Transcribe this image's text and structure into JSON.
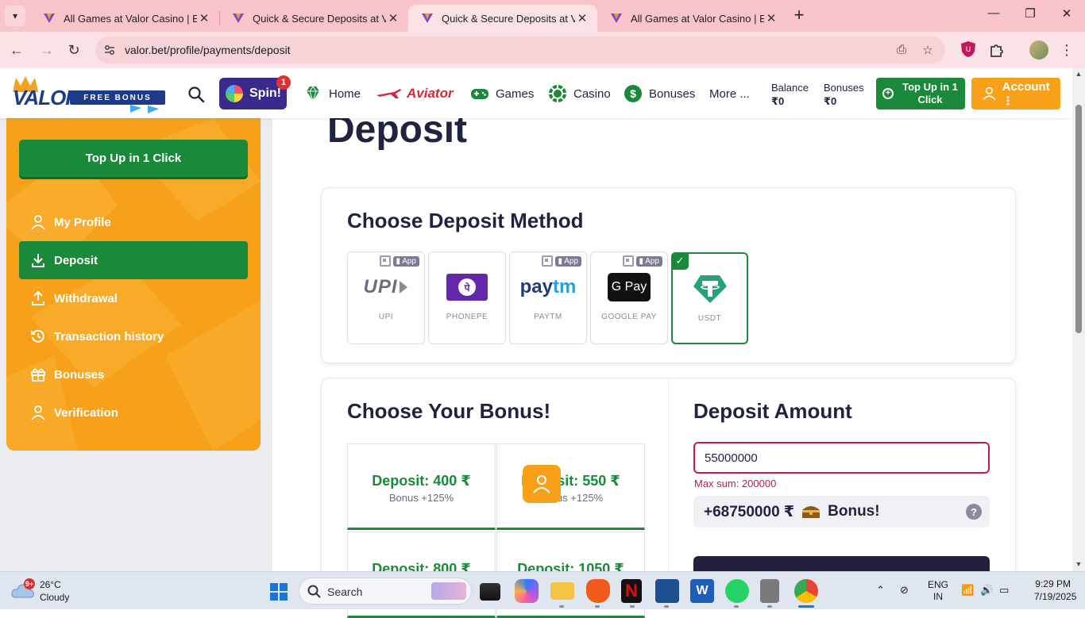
{
  "browser": {
    "tabs": [
      {
        "title": "All Games at Valor Casino | Expl",
        "active": false
      },
      {
        "title": "Quick & Secure Deposits at Valo",
        "active": false
      },
      {
        "title": "Quick & Secure Deposits at Valo",
        "active": true
      },
      {
        "title": "All Games at Valor Casino | Expl",
        "active": false
      }
    ],
    "url": "valor.bet/profile/payments/deposit"
  },
  "header": {
    "logo_text": "VALOR",
    "logo_badge": "FREE BONUS",
    "spin_label": "Spin!",
    "spin_badge": "1",
    "nav": {
      "home": "Home",
      "aviator": "Aviator",
      "games": "Games",
      "casino": "Casino",
      "bonuses": "Bonuses",
      "more": "More ..."
    },
    "balance_label": "Balance",
    "balance_value": "₹0",
    "bonuses_label": "Bonuses",
    "bonuses_value": "₹0",
    "topup_label": "Top Up in 1 Click",
    "account_label": "Account ⋮"
  },
  "sidebar": {
    "topup_label": "Top Up in 1 Click",
    "items": [
      {
        "label": "My Profile",
        "icon": "user-icon",
        "active": false
      },
      {
        "label": "Deposit",
        "icon": "download-icon",
        "active": true
      },
      {
        "label": "Withdrawal",
        "icon": "upload-icon",
        "active": false
      },
      {
        "label": "Transaction history",
        "icon": "history-icon",
        "active": false
      },
      {
        "label": "Bonuses",
        "icon": "gift-icon",
        "active": false
      },
      {
        "label": "Verification",
        "icon": "user-check-icon",
        "active": false
      }
    ]
  },
  "main": {
    "page_title": "Deposit",
    "methods_title": "Choose Deposit Method",
    "methods": [
      {
        "label": "UPI",
        "app_tag": "App",
        "selected": false
      },
      {
        "label": "PHONEPE",
        "app_tag": "",
        "selected": false
      },
      {
        "label": "PAYTM",
        "app_tag": "App",
        "selected": false
      },
      {
        "label": "GOOGLE PAY",
        "app_tag": "App",
        "selected": false
      },
      {
        "label": "USDT",
        "app_tag": "",
        "selected": true
      }
    ],
    "method_logos": {
      "upi": "UPI",
      "phonepe": "पे",
      "paytm_pay": "pay",
      "paytm_tm": "tm",
      "gpay": "G Pay"
    },
    "bonus_title": "Choose Your Bonus!",
    "bonus_options": [
      {
        "amount": "Deposit: 400 ₹",
        "bonus": "Bonus +125%"
      },
      {
        "amount": "Deposit: 550 ₹",
        "bonus": "Bonus +125%"
      },
      {
        "amount": "Deposit: 800 ₹",
        "bonus": ""
      },
      {
        "amount": "Deposit: 1050 ₹",
        "bonus": ""
      }
    ],
    "amount_title": "Deposit Amount",
    "amount_value": "55000000",
    "max_sum": "Max sum: 200000",
    "bonus_amount": "+68750000 ₹",
    "bonus_text": "Bonus!",
    "help": "?"
  },
  "taskbar": {
    "weather_temp": "26°C",
    "weather_desc": "Cloudy",
    "weather_badge": "9+",
    "search_placeholder": "Search",
    "lang_top": "ENG",
    "lang_bottom": "IN",
    "time": "9:29 PM",
    "date": "7/19/2025"
  },
  "colors": {
    "brand_orange": "#f7a11a",
    "brand_green": "#1a8a3a",
    "navy": "#1f2340",
    "error": "#c2185b"
  }
}
